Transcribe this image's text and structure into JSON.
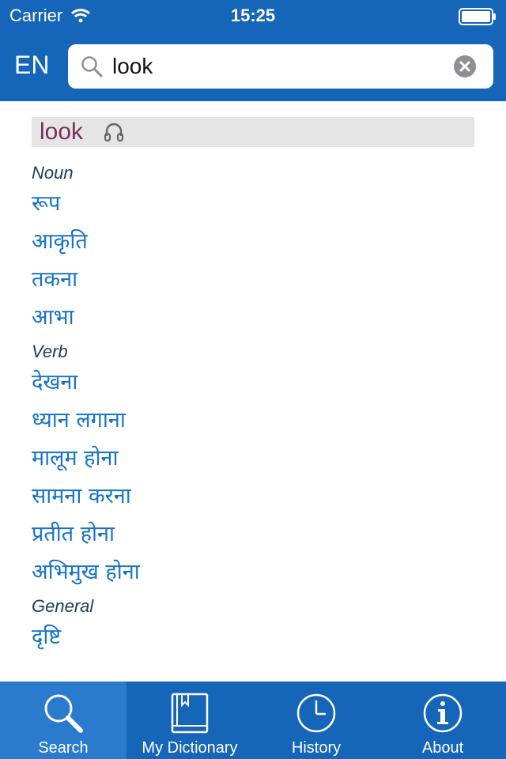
{
  "status_bar": {
    "carrier": "Carrier",
    "time": "15:25"
  },
  "header": {
    "language": "EN",
    "search": {
      "value": "look",
      "placeholder": ""
    }
  },
  "entry": {
    "headword": "look",
    "sections": [
      {
        "pos": "Noun",
        "translations": [
          "रूप",
          "आकृति",
          "तकना",
          "आभा"
        ]
      },
      {
        "pos": "Verb",
        "translations": [
          "देखना",
          "ध्यान लगाना",
          "मालूम होना",
          "सामना करना",
          "प्रतीत होना",
          "अभिमुख होना"
        ]
      },
      {
        "pos": "General",
        "translations": [
          "दृष्टि"
        ]
      }
    ]
  },
  "tabs": [
    {
      "label": "Search",
      "icon": "search-icon",
      "active": true
    },
    {
      "label": "My Dictionary",
      "icon": "book-icon",
      "active": false
    },
    {
      "label": "History",
      "icon": "clock-icon",
      "active": false
    },
    {
      "label": "About",
      "icon": "info-icon",
      "active": false
    }
  ],
  "colors": {
    "primary": "#1565b8",
    "active_tab": "#2a7acd",
    "headword": "#7a2f5a",
    "translation": "#1673c7",
    "pos": "#1a3d63"
  }
}
